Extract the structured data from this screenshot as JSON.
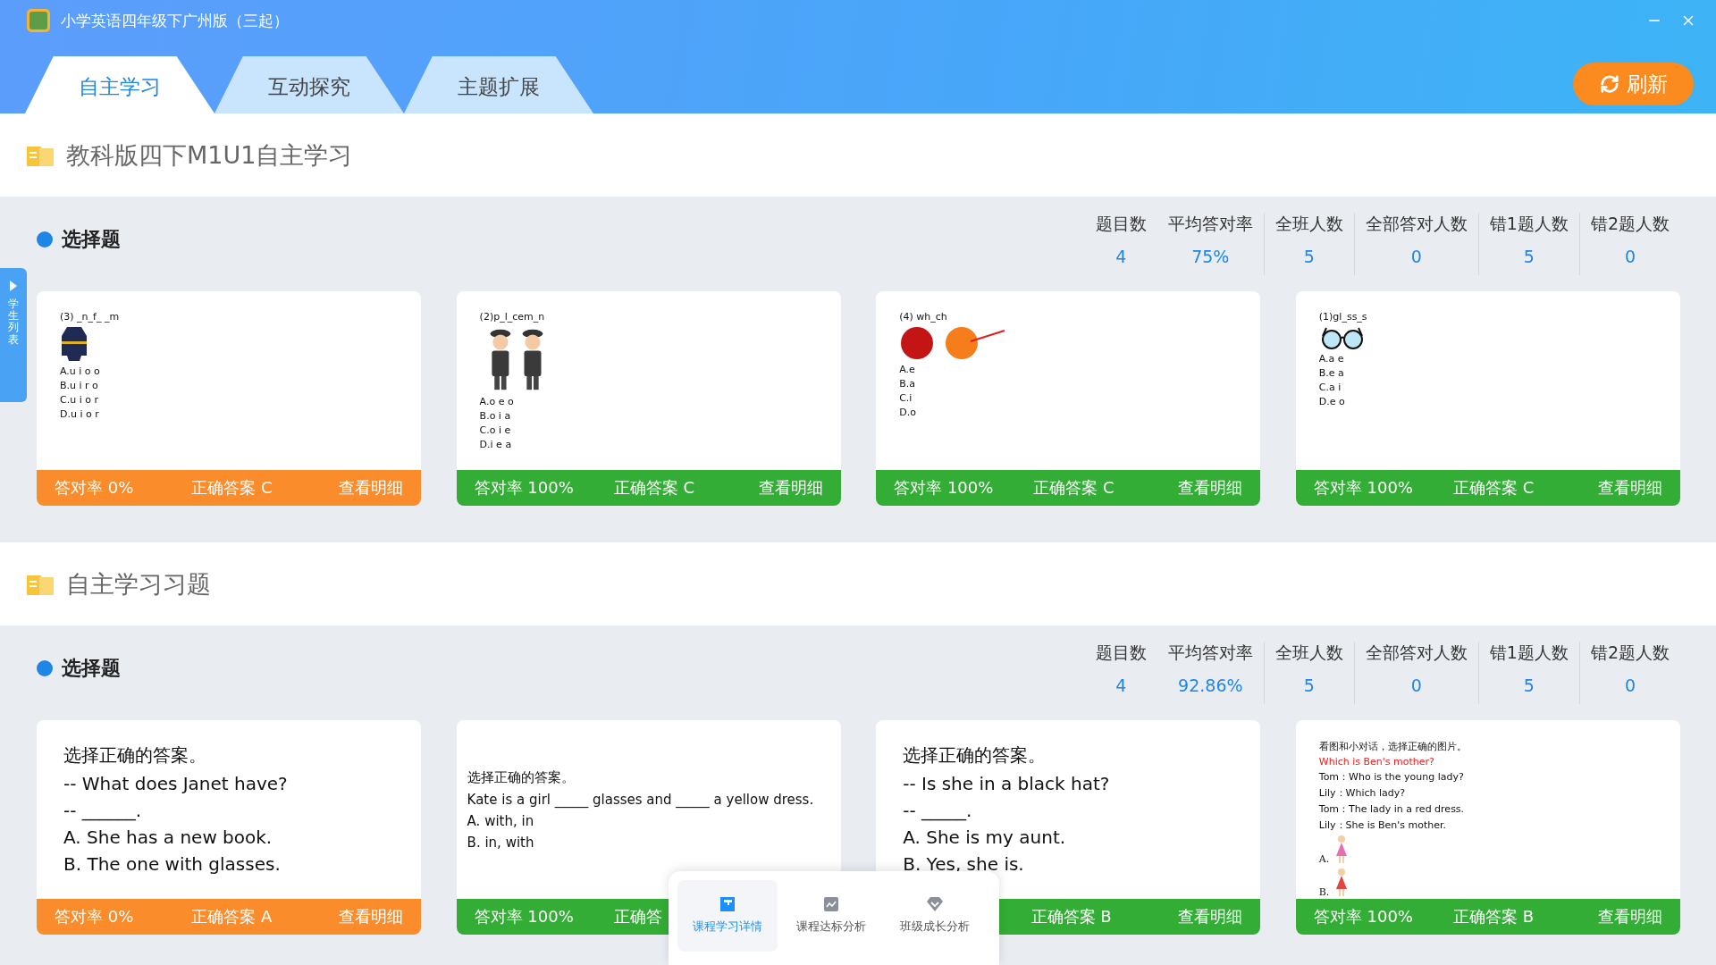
{
  "window": {
    "title": "小学英语四年级下广州版（三起）"
  },
  "tabs": [
    {
      "label": "自主学习",
      "selected": true
    },
    {
      "label": "互动探究",
      "selected": false
    },
    {
      "label": "主题扩展",
      "selected": false
    }
  ],
  "refresh_button": "刷新",
  "side_tab": "学生列表",
  "sections": [
    {
      "title": "教科版四下M1U1自主学习",
      "group": {
        "title": "选择题",
        "stats": [
          {
            "label": "题目数",
            "value": "4"
          },
          {
            "label": "平均答对率",
            "value": "75%"
          },
          {
            "label": "全班人数",
            "value": "5"
          },
          {
            "label": "全部答对人数",
            "value": "0"
          },
          {
            "label": "错1题人数",
            "value": "5"
          },
          {
            "label": "错2题人数",
            "value": "0"
          }
        ],
        "cards": [
          {
            "kind": "worksheet",
            "color": "#fb8c2c",
            "lines": [
              {
                "kind": "text",
                "text": "(3) _n_f_ _m"
              },
              {
                "kind": "uniform"
              },
              {
                "kind": "text",
                "text": "A.u i o o"
              },
              {
                "kind": "text",
                "text": "B.u i r o"
              },
              {
                "kind": "text",
                "text": "C.u i o r"
              },
              {
                "kind": "text",
                "text": "D.u i o r"
              }
            ],
            "footer": {
              "rate": "答对率 0%",
              "answer": "正确答案 C",
              "detail": "查看明细"
            }
          },
          {
            "kind": "worksheet",
            "color": "#33ad36",
            "lines": [
              {
                "kind": "text",
                "text": "(2)p_l_cem_n"
              },
              {
                "kind": "police"
              },
              {
                "kind": "text",
                "text": "A.o e o"
              },
              {
                "kind": "text",
                "text": "B.o i a"
              },
              {
                "kind": "text",
                "text": "C.o i e"
              },
              {
                "kind": "text",
                "text": "D.i e a"
              }
            ],
            "footer": {
              "rate": "答对率 100%",
              "answer": "正确答案 C",
              "detail": "查看明细"
            }
          },
          {
            "kind": "worksheet",
            "color": "#33ad36",
            "lines": [
              {
                "kind": "text",
                "text": "(4) wh_ch"
              },
              {
                "kind": "balls"
              },
              {
                "kind": "text",
                "text": "A.e"
              },
              {
                "kind": "text",
                "text": "B.a"
              },
              {
                "kind": "text",
                "text": "C.i"
              },
              {
                "kind": "text",
                "text": "D.o"
              }
            ],
            "footer": {
              "rate": "答对率 100%",
              "answer": "正确答案 C",
              "detail": "查看明细"
            }
          },
          {
            "kind": "worksheet",
            "color": "#33ad36",
            "lines": [
              {
                "kind": "text",
                "text": "(1)gl_ss_s"
              },
              {
                "kind": "glasses"
              },
              {
                "kind": "text",
                "text": "A.a e"
              },
              {
                "kind": "text",
                "text": "B.e a"
              },
              {
                "kind": "text",
                "text": "C.a i"
              },
              {
                "kind": "text",
                "text": "D.e o"
              }
            ],
            "footer": {
              "rate": "答对率 100%",
              "answer": "正确答案 C",
              "detail": "查看明细"
            }
          }
        ]
      }
    },
    {
      "title": "自主学习习题",
      "group": {
        "title": "选择题",
        "stats": [
          {
            "label": "题目数",
            "value": "4"
          },
          {
            "label": "平均答对率",
            "value": "92.86%"
          },
          {
            "label": "全班人数",
            "value": "5"
          },
          {
            "label": "全部答对人数",
            "value": "0"
          },
          {
            "label": "错1题人数",
            "value": "5"
          },
          {
            "label": "错2题人数",
            "value": "0"
          }
        ],
        "cards": [
          {
            "kind": "question",
            "color": "#fb8c2c",
            "lines": [
              {
                "kind": "prompt",
                "text": "选择正确的答案。"
              },
              {
                "kind": "text",
                "text": "-- What does Janet have?"
              },
              {
                "kind": "text",
                "text": "-- ______."
              },
              {
                "kind": "text",
                "text": "A. She has a new book."
              },
              {
                "kind": "text",
                "text": "B. The one with glasses."
              }
            ],
            "footer": {
              "rate": "答对率 0%",
              "answer": "正确答案 A",
              "detail": "查看明细"
            }
          },
          {
            "kind": "compact",
            "color": "#33ad36",
            "lines": [
              {
                "kind": "prompt",
                "text": "选择正确的答案。"
              },
              {
                "kind": "text",
                "text": "Kate is a girl _____ glasses and _____ a yellow dress."
              },
              {
                "kind": "text",
                "text": "A. with, in"
              },
              {
                "kind": "text",
                "text": "B. in, with"
              }
            ],
            "footer": {
              "rate": "答对率 100%",
              "answer": "正确答"
            }
          },
          {
            "kind": "question",
            "color": "#33ad36",
            "lines": [
              {
                "kind": "prompt",
                "text": "选择正确的答案。"
              },
              {
                "kind": "text",
                "text": "-- Is she in a black hat?"
              },
              {
                "kind": "text",
                "text": "-- _____."
              },
              {
                "kind": "text",
                "text": "A. She is my aunt."
              },
              {
                "kind": "text",
                "text": "B. Yes, she is."
              }
            ],
            "footer": {
              "answer": "正确答案 B",
              "detail": "查看明细"
            }
          },
          {
            "kind": "worksheet",
            "color": "#33ad36",
            "lines": [
              {
                "kind": "prompt",
                "text": "看图和小对话，选择正确的图片。"
              },
              {
                "kind": "red",
                "text": "Which is  Ben's mother?"
              },
              {
                "kind": "text",
                "text": "Tom：Who is the young lady?"
              },
              {
                "kind": "text",
                "text": "Lily：Which lady?"
              },
              {
                "kind": "text",
                "text": "Tom：The lady in a red dress."
              },
              {
                "kind": "text",
                "text": "Lily：She is Ben's mother."
              },
              {
                "kind": "girl-option",
                "text": "A.",
                "color": "#e66fb0"
              },
              {
                "kind": "girl-option",
                "text": "B.",
                "color": "#e0453e"
              }
            ],
            "footer": {
              "rate": "答对率 100%",
              "answer": "正确答案 B",
              "detail": "查看明细"
            }
          }
        ]
      }
    }
  ],
  "bottom_nav": [
    {
      "label": "课程学习详情",
      "kind": "book",
      "selected": true
    },
    {
      "label": "课程达标分析",
      "kind": "chart",
      "selected": false
    },
    {
      "label": "班级成长分析",
      "kind": "badge",
      "selected": false
    }
  ]
}
